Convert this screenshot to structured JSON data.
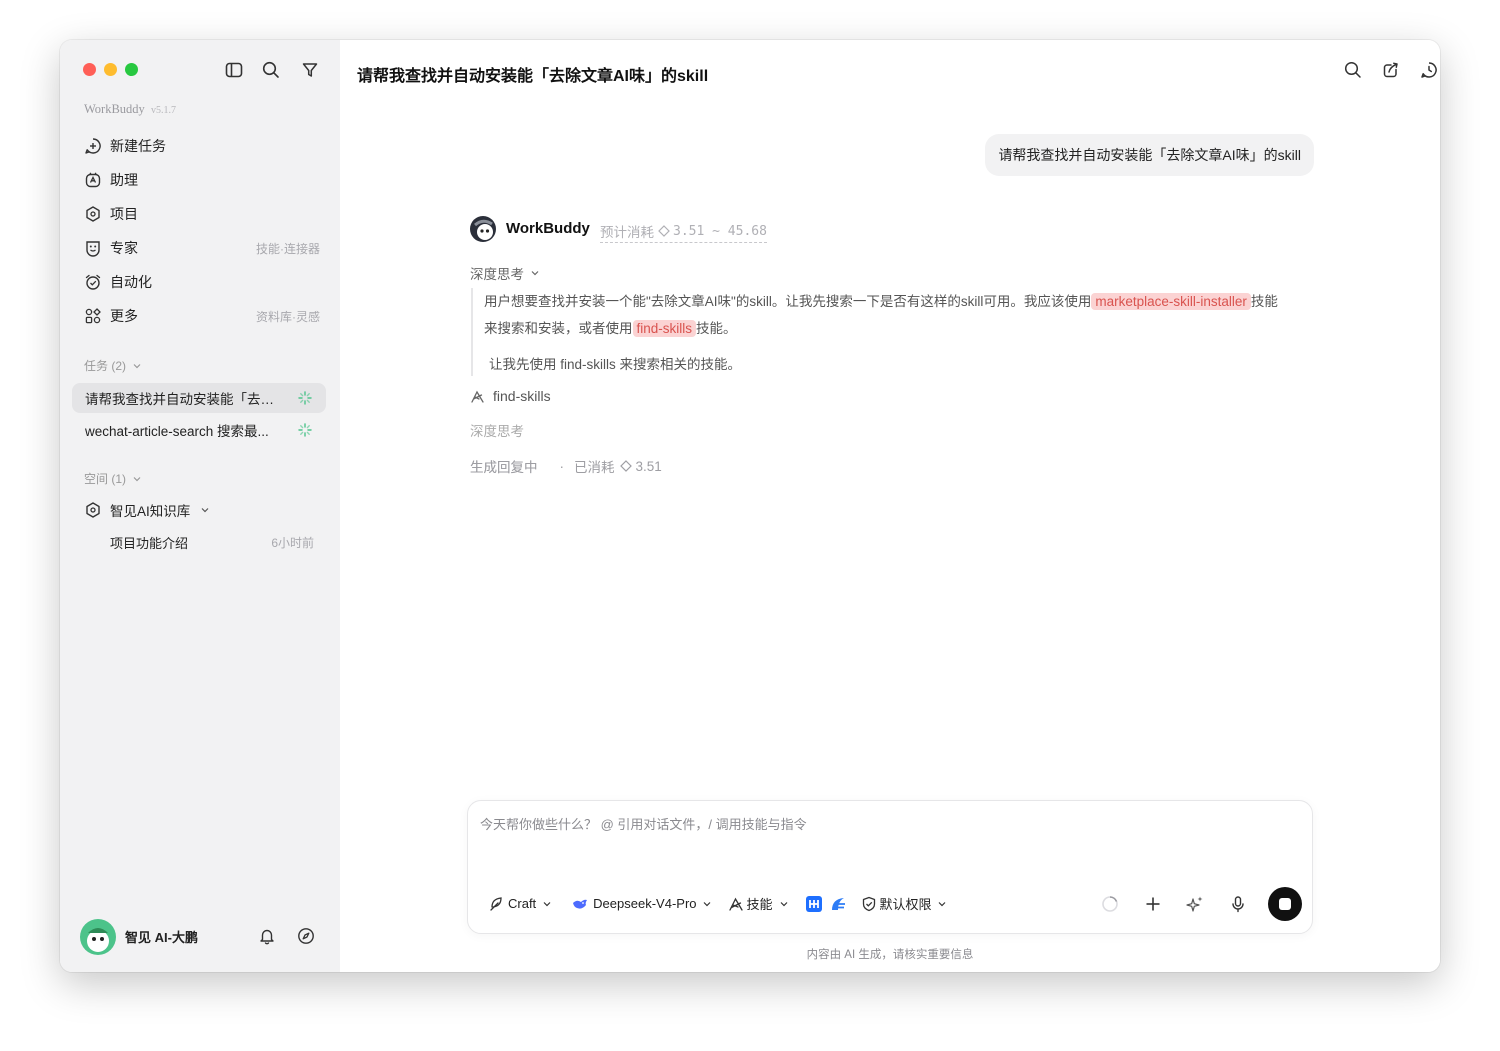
{
  "app": {
    "name": "WorkBuddy",
    "version": "v5.1.7"
  },
  "sidebar": {
    "nav": [
      {
        "label": "新建任务",
        "hint": "",
        "icon": "plus-circle-icon"
      },
      {
        "label": "助理",
        "hint": "",
        "icon": "assistant-icon"
      },
      {
        "label": "项目",
        "hint": "",
        "icon": "project-icon"
      },
      {
        "label": "专家",
        "hint": "技能·连接器",
        "icon": "expert-icon"
      },
      {
        "label": "自动化",
        "hint": "",
        "icon": "alarm-icon"
      },
      {
        "label": "更多",
        "hint": "资料库·灵感",
        "icon": "grid-icon"
      }
    ],
    "tasks_header": "任务 (2)",
    "tasks": [
      {
        "label": "请帮我查找并自动安装能「去除..."
      },
      {
        "label": "wechat-article-search 搜索最..."
      }
    ],
    "spaces_header": "空间 (1)",
    "space": {
      "label": "智见AI知识库"
    },
    "space_items": [
      {
        "label": "项目功能介绍",
        "time": "6小时前"
      }
    ],
    "user": {
      "name": "智见 AI-大鹏"
    }
  },
  "header": {
    "title": "请帮我查找并自动安装能「去除文章AI味」的skill"
  },
  "chat": {
    "user_message": "请帮我查找并自动安装能「去除文章AI味」的skill",
    "agent_name": "WorkBuddy",
    "estimate_label": "预计消耗",
    "estimate_range": "3.51 ~ 45.68",
    "thinking_label": "深度思考",
    "thinking_part1": "用户想要查找并安装一个能\"去除文章AI味\"的skill。让我先搜索一下是否有这样的skill可用。我应该使用",
    "thinking_hl1": "marketplace-skill-installer",
    "thinking_part2": "技能来搜索和安装，或者使用",
    "thinking_hl2": "find-skills",
    "thinking_part3": "技能。",
    "thinking_para2": "让我先使用 find-skills 来搜索相关的技能。",
    "tool_name": "find-skills",
    "thinking_label2": "深度思考",
    "status_generating": "生成回复中",
    "status_consumed_label": "已消耗",
    "status_consumed_value": "3.51"
  },
  "composer": {
    "placeholder": "今天帮你做些什么？ @ 引用对话文件，/ 调用技能与指令",
    "mode": "Craft",
    "model": "Deepseek-V4-Pro",
    "skills": "技能",
    "permission": "默认权限"
  },
  "footer_note": "内容由 AI 生成，请核实重要信息",
  "colors": {
    "accent_green": "#4cc38a",
    "highlight_bg": "#fbd3d3",
    "highlight_text": "#d9534f",
    "traffic_red": "#ff5f57",
    "traffic_yellow": "#febc2e",
    "traffic_green": "#28c840"
  }
}
